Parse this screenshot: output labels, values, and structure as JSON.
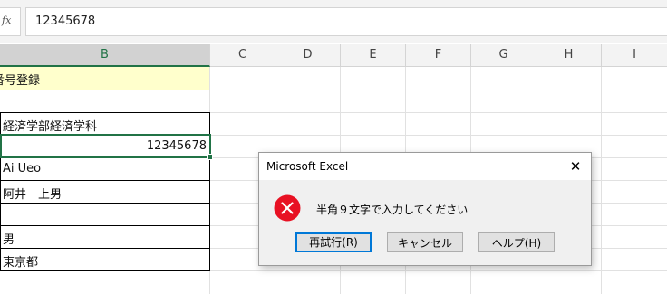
{
  "formula_bar": {
    "fx_label": "fx",
    "value": "12345678"
  },
  "grid": {
    "columns": [
      {
        "label": "B",
        "active": true
      },
      {
        "label": "C"
      },
      {
        "label": "D"
      },
      {
        "label": "E"
      },
      {
        "label": "F"
      },
      {
        "label": "G"
      },
      {
        "label": "H"
      },
      {
        "label": "I"
      }
    ],
    "cells": {
      "title": "番号登録",
      "faculty": "経済学部経済学科",
      "number": "12345678",
      "romaji": "Ai Ueo",
      "kanji_name": "阿井　上男",
      "gender": "男",
      "address": "東京都"
    },
    "colors": {
      "title_fill": "#ffffcc",
      "selection": "#217346"
    }
  },
  "dialog": {
    "title": "Microsoft Excel",
    "close_glyph": "✕",
    "message": "半角９文字で入力してください",
    "icon": "error-icon",
    "buttons": {
      "retry": "再試行(R)",
      "cancel": "キャンセル",
      "help": "ヘルプ(H)"
    },
    "colors": {
      "error_red": "#e81123",
      "default_border": "#0078d7"
    }
  }
}
